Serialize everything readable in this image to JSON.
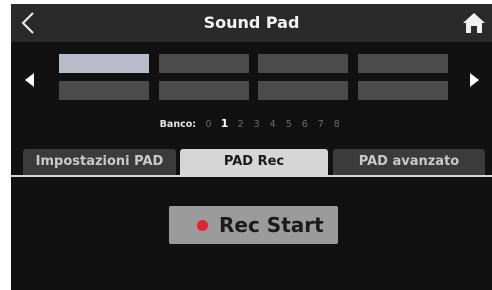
{
  "header": {
    "title": "Sound Pad",
    "back_icon": "chevron-left-icon",
    "home_icon": "home-icon"
  },
  "pads": {
    "selected_index": 0,
    "rows": 2,
    "columns": 4
  },
  "bank": {
    "label": "Banco:",
    "numbers": [
      "0",
      "1",
      "2",
      "3",
      "4",
      "5",
      "6",
      "7",
      "8"
    ],
    "active": "1"
  },
  "tabs": [
    {
      "label": "Impostazioni PAD",
      "active": false
    },
    {
      "label": "PAD Rec",
      "active": true
    },
    {
      "label": "PAD avanzato",
      "active": false
    }
  ],
  "rec_button": {
    "label": "Rec Start",
    "dot_color": "#e5232f"
  },
  "colors": {
    "header_bg": "#2a2a2a",
    "screen_bg": "#111111",
    "pad": "#4b4b4b",
    "pad_selected": "#b9bccb",
    "tab_active": "#d6d6d6",
    "tab_inactive": "#3b3b3b",
    "button": "#9b9b9b"
  }
}
